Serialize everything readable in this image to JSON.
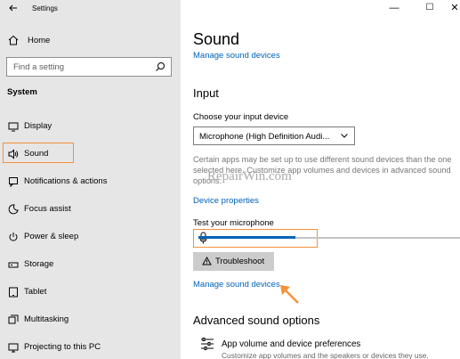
{
  "window": {
    "title": "Settings",
    "back_icon": "back-arrow-icon",
    "minimize_glyph": "—",
    "maximize_glyph": "☐",
    "close_glyph": "✕"
  },
  "sidebar": {
    "home_label": "Home",
    "search_placeholder": "Find a setting",
    "section_label": "System",
    "items": [
      {
        "label": "Display",
        "icon": "display-icon"
      },
      {
        "label": "Sound",
        "icon": "speaker-icon",
        "selected": true
      },
      {
        "label": "Notifications & actions",
        "icon": "notifications-icon"
      },
      {
        "label": "Focus assist",
        "icon": "moon-icon"
      },
      {
        "label": "Power & sleep",
        "icon": "power-icon"
      },
      {
        "label": "Storage",
        "icon": "storage-icon"
      },
      {
        "label": "Tablet",
        "icon": "tablet-icon"
      },
      {
        "label": "Multitasking",
        "icon": "multitasking-icon"
      },
      {
        "label": "Projecting to this PC",
        "icon": "projecting-icon"
      }
    ]
  },
  "main": {
    "title": "Sound",
    "top_link": "Manage sound devices",
    "input_heading": "Input",
    "choose_device_label": "Choose your input device",
    "device_selected": "Microphone (High Definition Audi...",
    "description": "Certain apps may be set up to use different sound devices than the one selected here. Customize app volumes and devices in advanced sound options.",
    "watermark": "RepairWin.com",
    "device_properties_link": "Device properties",
    "test_mic_label": "Test your microphone",
    "mic_level": 0.37,
    "troubleshoot_label": "Troubleshoot",
    "manage_link": "Manage sound devices",
    "advanced_heading": "Advanced sound options",
    "app_volume_title": "App volume and device preferences",
    "app_volume_sub": "Customize app volumes and the speakers or devices they use."
  },
  "colors": {
    "accent": "#0062b8",
    "highlight": "#f5913b",
    "sidebar_bg": "#e6e6e6"
  }
}
